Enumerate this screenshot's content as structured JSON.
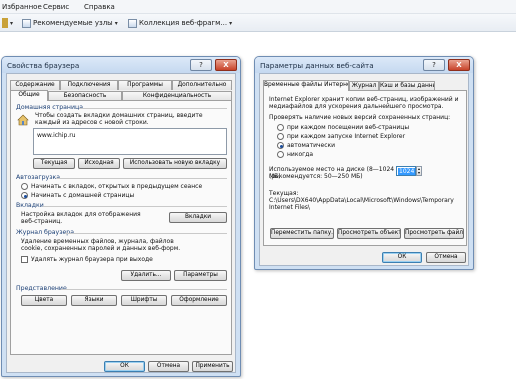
{
  "menubar": {
    "items": [
      "Избранное",
      "Сервис",
      "Справка"
    ]
  },
  "favorites_bar": {
    "suggested_sites": "Рекомендуемые узлы",
    "web_slice_gallery": "Коллекция веб-фрагм..."
  },
  "browser_properties": {
    "title": "Свойства браузера",
    "help_glyph": "?",
    "close_glyph": "X",
    "tabs_row1": [
      "Содержание",
      "Подключения",
      "Программы",
      "Дополнительно"
    ],
    "tabs_row2": [
      "Общие",
      "Безопасность",
      "Конфиденциальность"
    ],
    "home": {
      "title": "Домашняя страница",
      "description": "Чтобы создать вкладки домашних страниц, введите каждый из адресов с новой строки.",
      "url_value": "www.ichip.ru",
      "btn_current": "Текущая",
      "btn_original": "Исходная",
      "btn_new_tab": "Использовать новую вкладку"
    },
    "startup": {
      "title": "Автозагрузка",
      "option_restore": "Начинать с вкладок, открытых в предыдущем сеансе",
      "option_home": "Начинать с домашней страницы",
      "selected": "option_home"
    },
    "tabs_section": {
      "title": "Вкладки",
      "description": "Настройка вкладок для отображения веб-страниц.",
      "btn": "Вкладки"
    },
    "history": {
      "title": "Журнал браузера",
      "description": "Удаление временных файлов, журнала, файлов cookie, сохраненных паролей и данных веб-форм.",
      "checkbox_label": "Удалять журнал браузера при выходе",
      "btn_delete": "Удалить...",
      "btn_params": "Параметры"
    },
    "appearance": {
      "title": "Представление",
      "btn_colors": "Цвета",
      "btn_languages": "Языки",
      "btn_fonts": "Шрифты",
      "btn_design": "Оформление"
    },
    "footer": {
      "ok": "ОК",
      "cancel": "Отмена",
      "apply": "Применить"
    }
  },
  "website_data": {
    "title": "Параметры данных веб-сайта",
    "help_glyph": "?",
    "close_glyph": "X",
    "tabs": [
      "Временные файлы Интернета",
      "Журнал",
      "Кэш и базы данных"
    ],
    "description": "Internet Explorer хранит копии веб-страниц, изображений и медиафайлов для ускорения дальнейшего просмотра.",
    "check_label": "Проверять наличие новых версий сохраненных страниц:",
    "options": [
      "при каждом посещении веб-страницы",
      "при каждом запуске Internet Explorer",
      "автоматически",
      "никогда"
    ],
    "selected_option": 2,
    "disk_label": "Используемое место на диске (8—1024 МБ)",
    "disk_recommended": "(рекомендуется: 50—250 МБ)",
    "disk_value": "1024",
    "current_label": "Текущая:",
    "current_path": "C:\\Users\\DX640\\AppData\\Local\\Microsoft\\Windows\\Temporary Internet Files\\",
    "btn_move": "Переместить папку...",
    "btn_objects": "Просмотреть объекты",
    "btn_files": "Просмотреть файлы",
    "ok": "ОК",
    "cancel": "Отмена"
  }
}
